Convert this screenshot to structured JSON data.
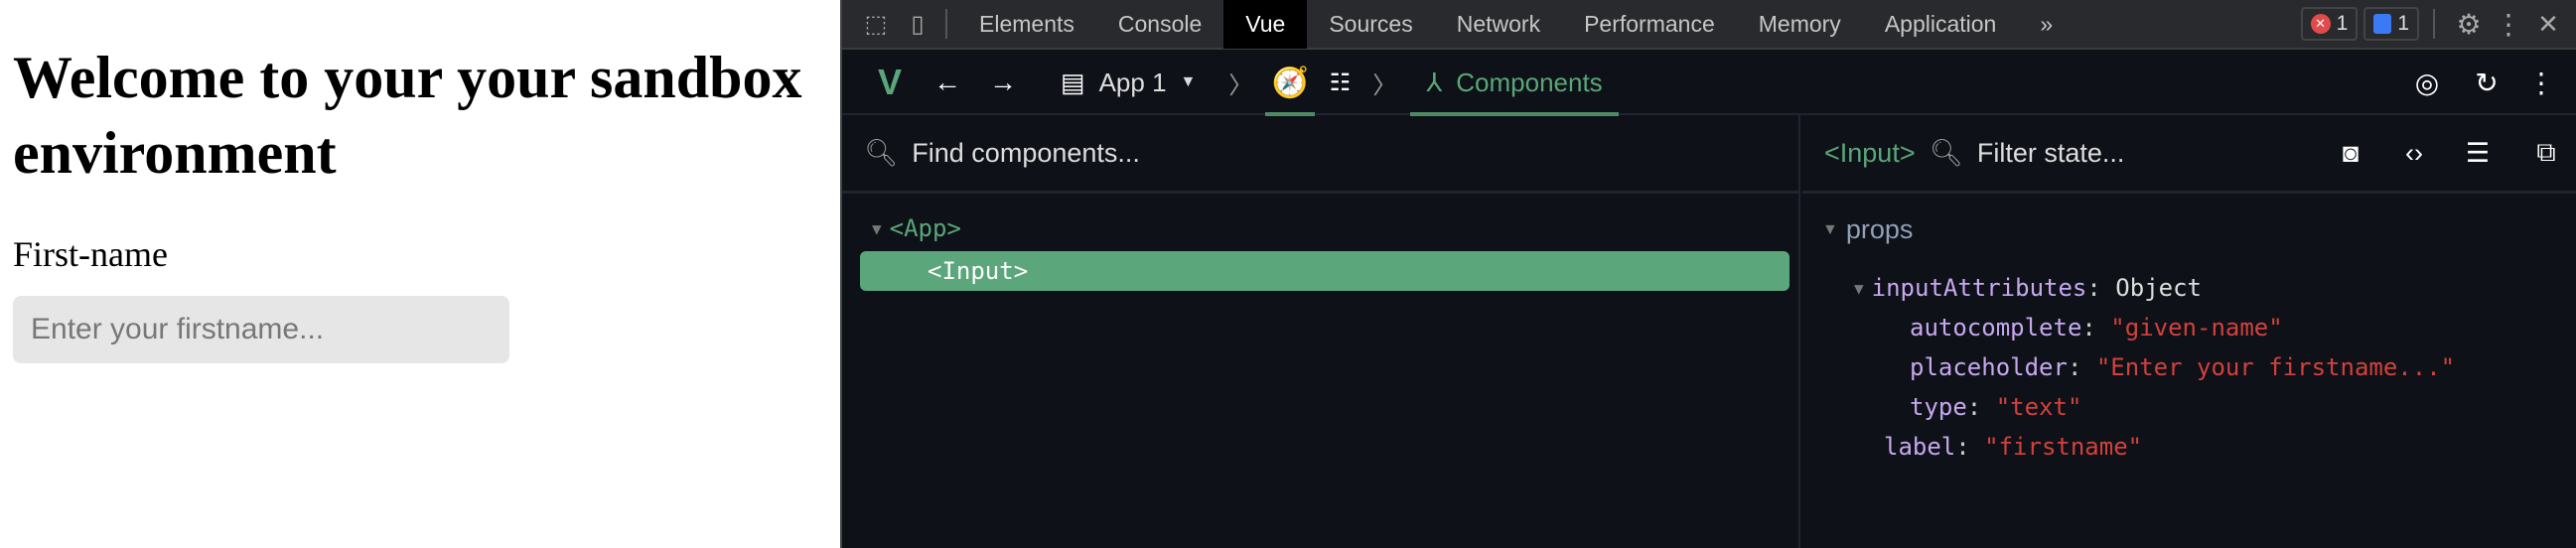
{
  "page": {
    "heading": "Welcome to your your sandbox environment",
    "label": "First-name",
    "input_placeholder": "Enter your firstname..."
  },
  "devtools": {
    "tabs": [
      "Elements",
      "Console",
      "Vue",
      "Sources",
      "Network",
      "Performance",
      "Memory",
      "Application"
    ],
    "more": "»",
    "error_count": "1",
    "message_count": "1",
    "toolbar": {
      "app": "App 1",
      "components": "Components"
    },
    "find_placeholder": "Find components...",
    "tree": {
      "app": "<App>",
      "input": "<Input>"
    },
    "inspector": {
      "selected": "<Input>",
      "filter_placeholder": "Filter state...",
      "section": "props",
      "rows": [
        {
          "key": "inputAttributes",
          "value": "Object",
          "type": "obj"
        },
        {
          "key": "autocomplete",
          "value": "\"given-name\"",
          "type": "str"
        },
        {
          "key": "placeholder",
          "value": "\"Enter your firstname...\"",
          "type": "str"
        },
        {
          "key": "type",
          "value": "\"text\"",
          "type": "str"
        },
        {
          "key": "label",
          "value": "\"firstname\"",
          "type": "str"
        }
      ]
    }
  }
}
